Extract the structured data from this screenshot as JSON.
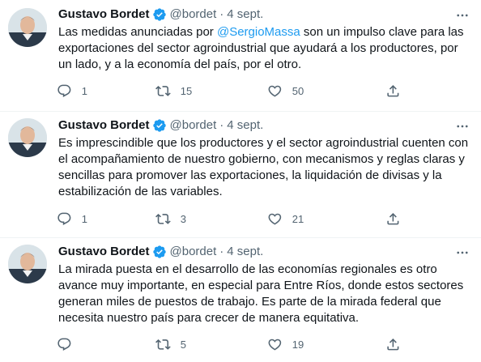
{
  "tweets": [
    {
      "name": "Gustavo Bordet",
      "handle": "@bordet",
      "separator": "·",
      "date": "4 sept.",
      "text_before": "Las medidas anunciadas por ",
      "mention": "@SergioMassa",
      "text_after": " son un impulso clave para las exportaciones del sector agroindustrial que ayudará a los productores, por un lado, y a la economía del país, por el otro.",
      "replies": "1",
      "retweets": "15",
      "likes": "50"
    },
    {
      "name": "Gustavo Bordet",
      "handle": "@bordet",
      "separator": "·",
      "date": "4 sept.",
      "text": "Es imprescindible que los productores y el sector agroindustrial cuenten con el acompañamiento de nuestro gobierno, con mecanismos y reglas claras y sencillas para promover las exportaciones, la liquidación de divisas y la estabilización de las variables.",
      "replies": "1",
      "retweets": "3",
      "likes": "21"
    },
    {
      "name": "Gustavo Bordet",
      "handle": "@bordet",
      "separator": "·",
      "date": "4 sept.",
      "text": "La mirada puesta en el desarrollo de las economías regionales es otro avance muy importante, en especial para Entre Ríos, donde estos sectores generan miles de puestos de trabajo. Es parte de la mirada federal que necesita nuestro país para crecer de manera equitativa.",
      "replies": "",
      "retweets": "5",
      "likes": "19"
    }
  ],
  "icons": {
    "verified": "verified-badge-icon",
    "more": "more-dots-icon",
    "reply": "reply-icon",
    "retweet": "retweet-icon",
    "like": "heart-icon",
    "share": "share-icon"
  },
  "colors": {
    "text": "#0f1419",
    "secondary": "#536471",
    "accent": "#1d9bf0",
    "divider": "#eff3f4"
  }
}
